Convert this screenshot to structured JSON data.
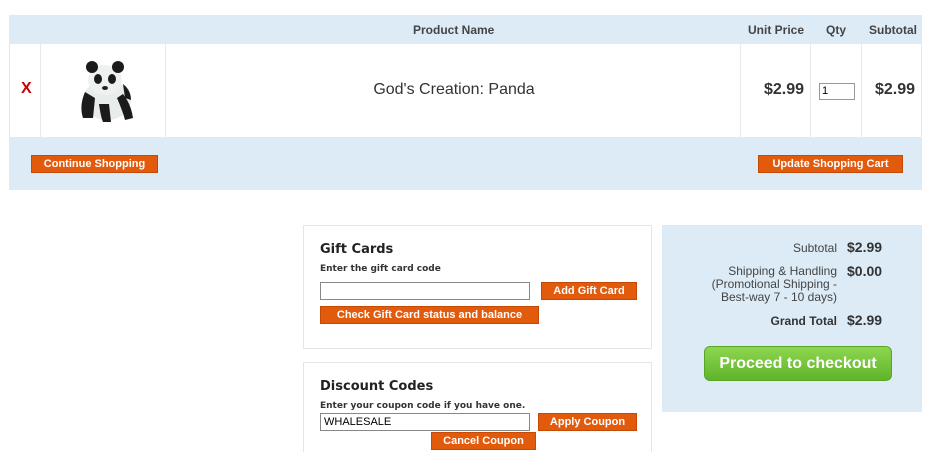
{
  "cart": {
    "headers": {
      "product_name": "Product Name",
      "unit_price": "Unit Price",
      "qty": "Qty",
      "subtotal": "Subtotal"
    },
    "item": {
      "remove_label": "X",
      "name": "God's Creation: Panda",
      "unit_price": "$2.99",
      "qty": "1",
      "subtotal": "$2.99",
      "image_icon": "panda-figure-image"
    },
    "continue_label": "Continue Shopping",
    "update_label": "Update Shopping Cart"
  },
  "gift_cards": {
    "title": "Gift Cards",
    "prompt": "Enter the gift card code",
    "code_value": "",
    "add_label": "Add Gift Card",
    "check_label": "Check Gift Card status and balance"
  },
  "discount": {
    "title": "Discount Codes",
    "prompt": "Enter your coupon code if you have one.",
    "code_value": "WHALESALE",
    "apply_label": "Apply Coupon",
    "cancel_label": "Cancel Coupon"
  },
  "totals": {
    "subtotal_label": "Subtotal",
    "subtotal_value": "$2.99",
    "shipping_label_1": "Shipping & Handling",
    "shipping_label_2": "(Promotional Shipping -",
    "shipping_label_3": "Best-way 7 - 10 days)",
    "shipping_value": "$0.00",
    "grand_label": "Grand Total",
    "grand_value": "$2.99",
    "checkout_label": "Proceed to checkout"
  },
  "colors": {
    "header_bg": "#dcebf5",
    "button_orange": "#e25a0c",
    "checkout_green": "#6cc234",
    "remove_red": "#cc0000"
  }
}
